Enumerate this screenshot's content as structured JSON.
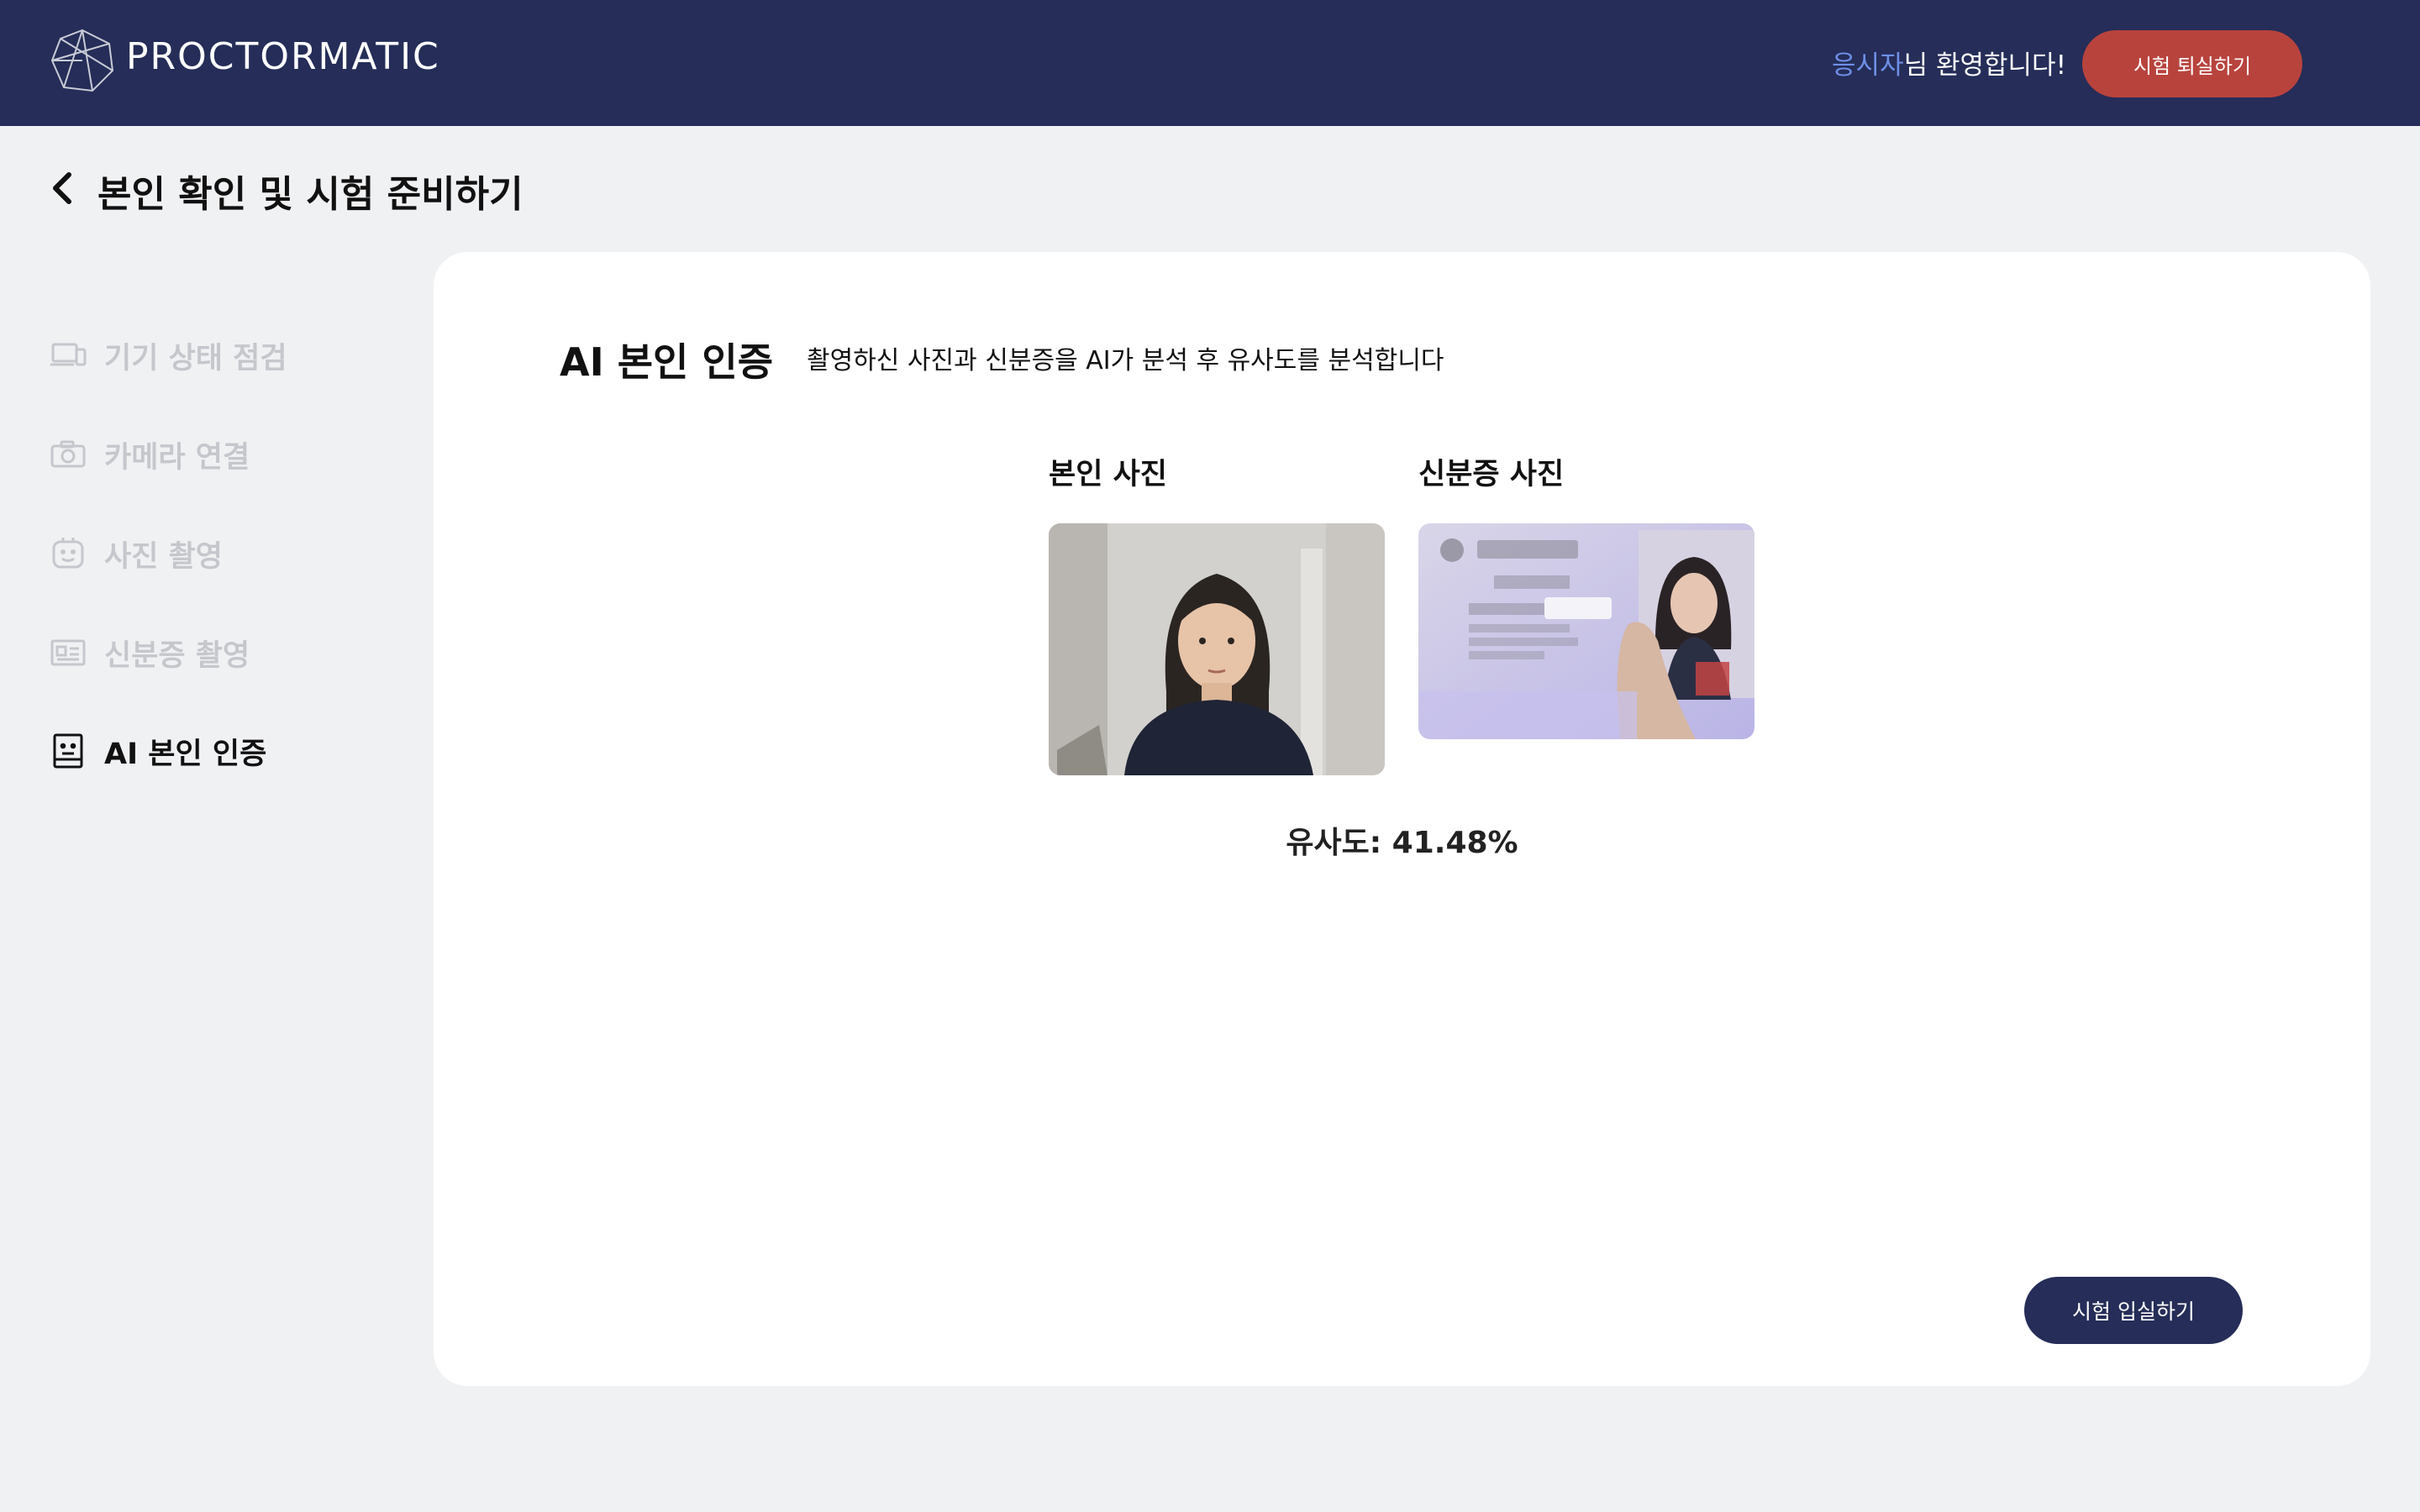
{
  "header": {
    "brand": "PROCTORMATIC",
    "welcome_role": "응시자",
    "welcome_text": "님 환영합니다!",
    "exit_button": "시험 퇴실하기"
  },
  "page": {
    "title": "본인 확인 및 시험 준비하기"
  },
  "sidebar": {
    "items": [
      {
        "label": "기기 상태 점검",
        "icon": "device-icon",
        "active": false
      },
      {
        "label": "카메라 연결",
        "icon": "camera-icon",
        "active": false
      },
      {
        "label": "사진 촬영",
        "icon": "face-icon",
        "active": false
      },
      {
        "label": "신분증 촬영",
        "icon": "id-card-icon",
        "active": false
      },
      {
        "label": "AI 본인 인증",
        "icon": "ai-face-icon",
        "active": true
      }
    ]
  },
  "main": {
    "title": "AI 본인 인증",
    "description": "촬영하신 사진과 신분증을 AI가 분석 후 유사도를 분석합니다",
    "selfie_label": "본인 사진",
    "id_label": "신분증 사진",
    "similarity": "유사도: 41.48%",
    "enter_button": "시험 입실하기"
  },
  "colors": {
    "header_bg": "#252d58",
    "exit_button": "#b8433d",
    "accent_blue": "#6f8fe8",
    "page_bg": "#f0f1f3"
  }
}
